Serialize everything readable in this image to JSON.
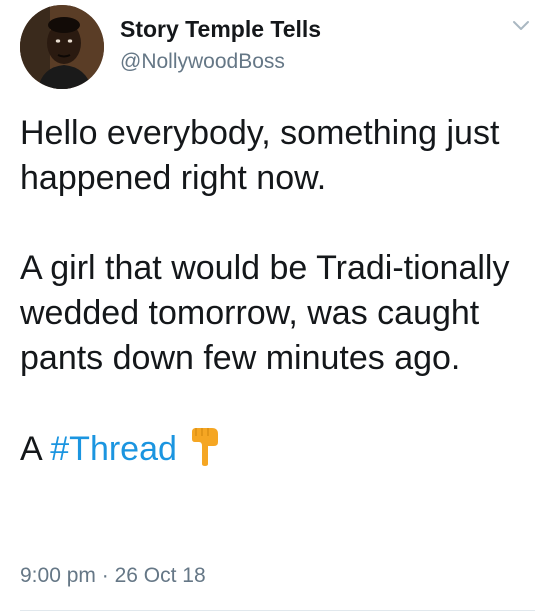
{
  "author": {
    "display_name": "Story Temple Tells",
    "handle": "@NollywoodBoss",
    "avatar_icon": "profile-photo"
  },
  "menu": {
    "icon": "chevron-down-icon"
  },
  "tweet": {
    "paragraph_1": "Hello everybody, something just happened right now.",
    "paragraph_2": "A girl that would be Tradi-tionally wedded tomorrow, was caught pants down few minutes ago.",
    "thread_prefix": "A",
    "hashtag": "#Thread",
    "emoji_icon": "backhand-index-pointing-down-icon"
  },
  "meta": {
    "time": "9:00 pm",
    "separator": "·",
    "date": "26 Oct 18"
  },
  "colors": {
    "text": "#14171a",
    "secondary": "#657786",
    "link": "#1b95e0",
    "divider": "#e1e8ed"
  }
}
